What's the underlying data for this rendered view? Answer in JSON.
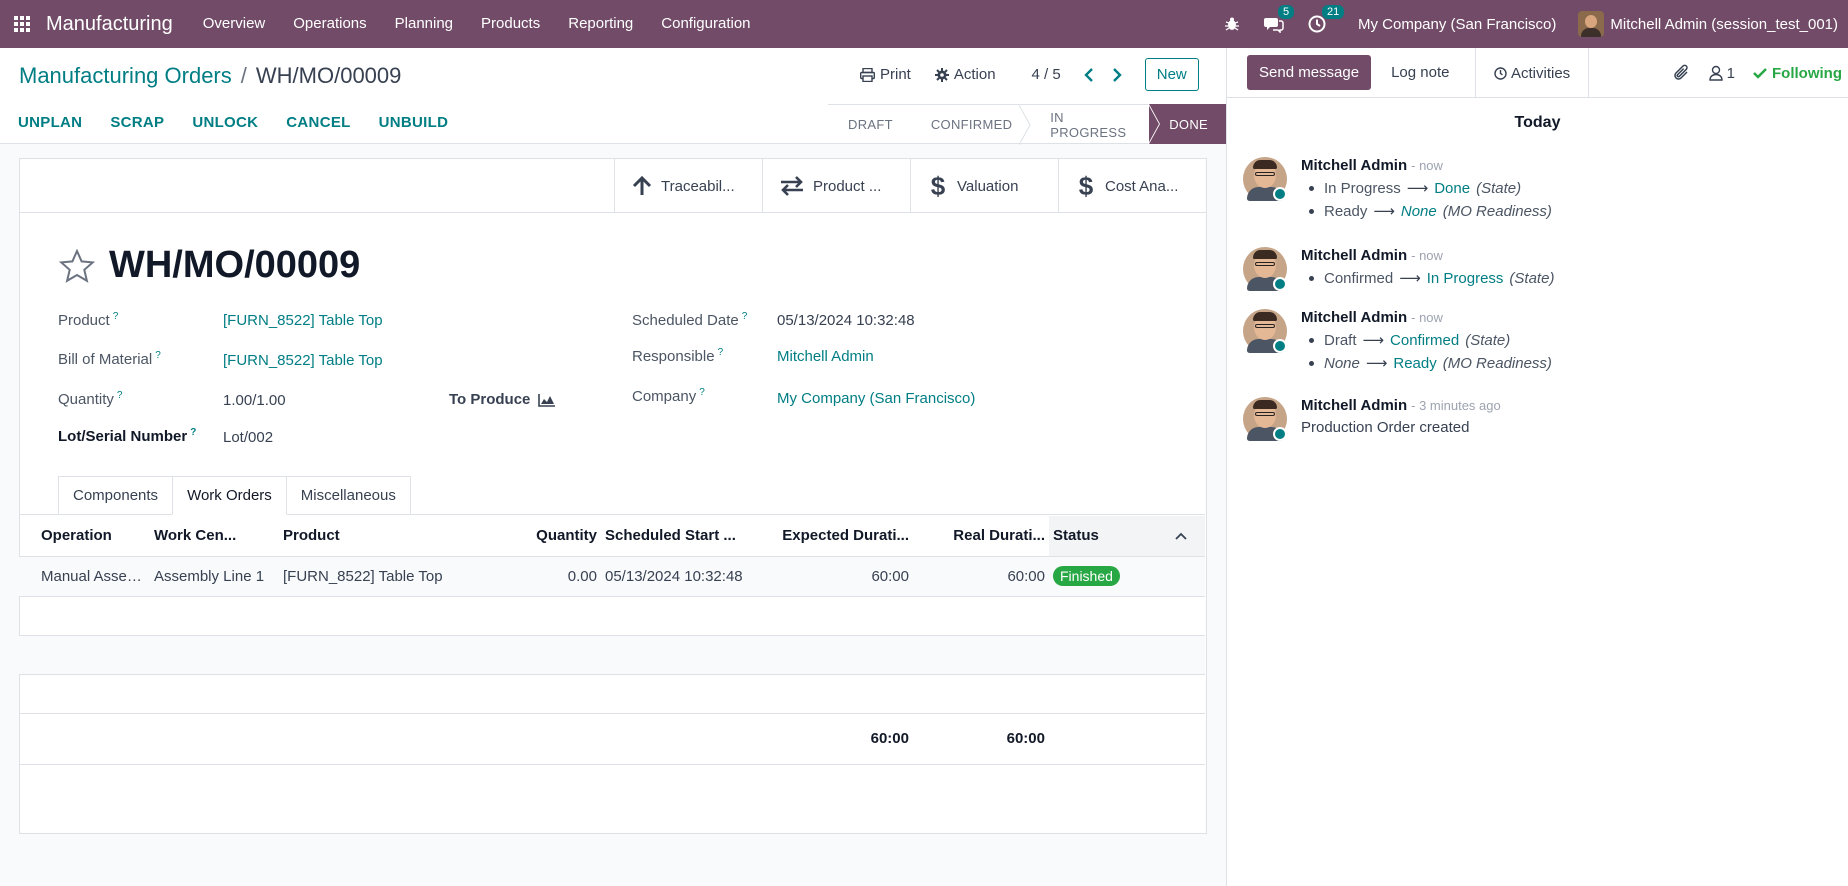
{
  "navbar": {
    "app_name": "Manufacturing",
    "menu": [
      "Overview",
      "Operations",
      "Planning",
      "Products",
      "Reporting",
      "Configuration"
    ],
    "messages_count": "5",
    "activities_count": "21",
    "company": "My Company (San Francisco)",
    "user": "Mitchell Admin (session_test_001)"
  },
  "breadcrumb": {
    "parent": "Manufacturing Orders",
    "separator": "/",
    "current": "WH/MO/00009"
  },
  "control": {
    "print_label": "Print",
    "action_label": "Action",
    "pager": "4 / 5",
    "new_label": "New"
  },
  "status_buttons": [
    "UNPLAN",
    "SCRAP",
    "UNLOCK",
    "CANCEL",
    "UNBUILD"
  ],
  "statusbar": {
    "stages": [
      "DRAFT",
      "CONFIRMED",
      "IN PROGRESS",
      "DONE"
    ],
    "active": "DONE"
  },
  "smart_buttons": [
    "Traceabil...",
    "Product ...",
    "Valuation",
    "Cost Ana..."
  ],
  "record": {
    "title": "WH/MO/00009",
    "product_label": "Product",
    "product_value": "[FURN_8522] Table Top",
    "bom_label": "Bill of Material",
    "bom_value": "[FURN_8522] Table Top",
    "quantity_label": "Quantity",
    "quantity_value": "1.00/1.00",
    "to_produce_label": "To Produce",
    "lot_label": "Lot/Serial Number",
    "lot_value": "Lot/002",
    "scheduled_label": "Scheduled Date",
    "scheduled_value": "05/13/2024 10:32:48",
    "responsible_label": "Responsible",
    "responsible_value": "Mitchell Admin",
    "company_label": "Company",
    "company_value": "My Company (San Francisco)",
    "help_mark": "?"
  },
  "tabs": [
    "Components",
    "Work Orders",
    "Miscellaneous"
  ],
  "active_tab": "Work Orders",
  "work_orders": {
    "columns": [
      "Operation",
      "Work Cen...",
      "Product",
      "Quantity",
      "Scheduled Start ...",
      "Expected Durati...",
      "Real Durati...",
      "Status"
    ],
    "rows": [
      {
        "operation": "Manual Assem...",
        "work_center": "Assembly Line 1",
        "product": "[FURN_8522] Table Top",
        "quantity": "0.00",
        "scheduled_start": "05/13/2024 10:32:48",
        "expected_duration": "60:00",
        "real_duration": "60:00",
        "status": "Finished"
      }
    ],
    "totals": {
      "expected_duration": "60:00",
      "real_duration": "60:00"
    }
  },
  "chatter": {
    "send_message": "Send message",
    "log_note": "Log note",
    "activities": "Activities",
    "followers_count": "1",
    "following": "Following",
    "date_separator": "Today",
    "messages": [
      {
        "author": "Mitchell Admin",
        "date": "- now",
        "changes": [
          {
            "old": "In Progress",
            "new": "Done",
            "field": "(State)"
          },
          {
            "old": "Ready",
            "new": "None",
            "field": "(MO Readiness)"
          }
        ]
      },
      {
        "author": "Mitchell Admin",
        "date": "- now",
        "changes": [
          {
            "old": "Confirmed",
            "new": "In Progress",
            "field": "(State)"
          }
        ]
      },
      {
        "author": "Mitchell Admin",
        "date": "- now",
        "changes": [
          {
            "old": "Draft",
            "new": "Confirmed",
            "field": "(State)"
          },
          {
            "old": "None",
            "new": "Ready",
            "field": "(MO Readiness)"
          }
        ]
      },
      {
        "author": "Mitchell Admin",
        "date": "- 3 minutes ago",
        "body": "Production Order created"
      }
    ]
  },
  "colors": {
    "brand": "#714b67",
    "link": "#017e84",
    "success": "#28a745"
  }
}
